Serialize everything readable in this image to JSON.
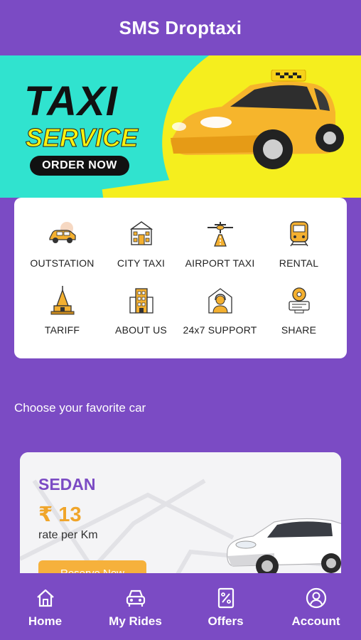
{
  "app": {
    "title": "SMS Droptaxi"
  },
  "banner": {
    "line1": "TAXI",
    "line2": "SERVICE",
    "cta": "ORDER NOW"
  },
  "services": [
    {
      "label": "OUTSTATION",
      "icon": "car-icon"
    },
    {
      "label": "CITY TAXI",
      "icon": "building-icon"
    },
    {
      "label": "AIRPORT TAXI",
      "icon": "airplane-icon"
    },
    {
      "label": "RENTAL",
      "icon": "train-icon"
    },
    {
      "label": "TARIFF",
      "icon": "temple-icon"
    },
    {
      "label": "ABOUT US",
      "icon": "office-icon"
    },
    {
      "label": "24x7 SUPPORT",
      "icon": "support-icon"
    },
    {
      "label": "SHARE",
      "icon": "share-icon"
    }
  ],
  "section": {
    "choose_label": "Choose your favorite car"
  },
  "car_card": {
    "type": "SEDAN",
    "price": "₹ 13",
    "rate_label": "rate per Km",
    "button": "Reserve Now"
  },
  "nav": [
    {
      "label": "Home",
      "icon": "home-icon"
    },
    {
      "label": "My Rides",
      "icon": "car-front-icon"
    },
    {
      "label": "Offers",
      "icon": "percent-tag-icon"
    },
    {
      "label": "Account",
      "icon": "account-icon"
    }
  ],
  "colors": {
    "primary": "#7b4bc4",
    "accent": "#f0a52a",
    "banner_teal": "#30e3cf",
    "banner_yellow": "#f5ee1e"
  }
}
